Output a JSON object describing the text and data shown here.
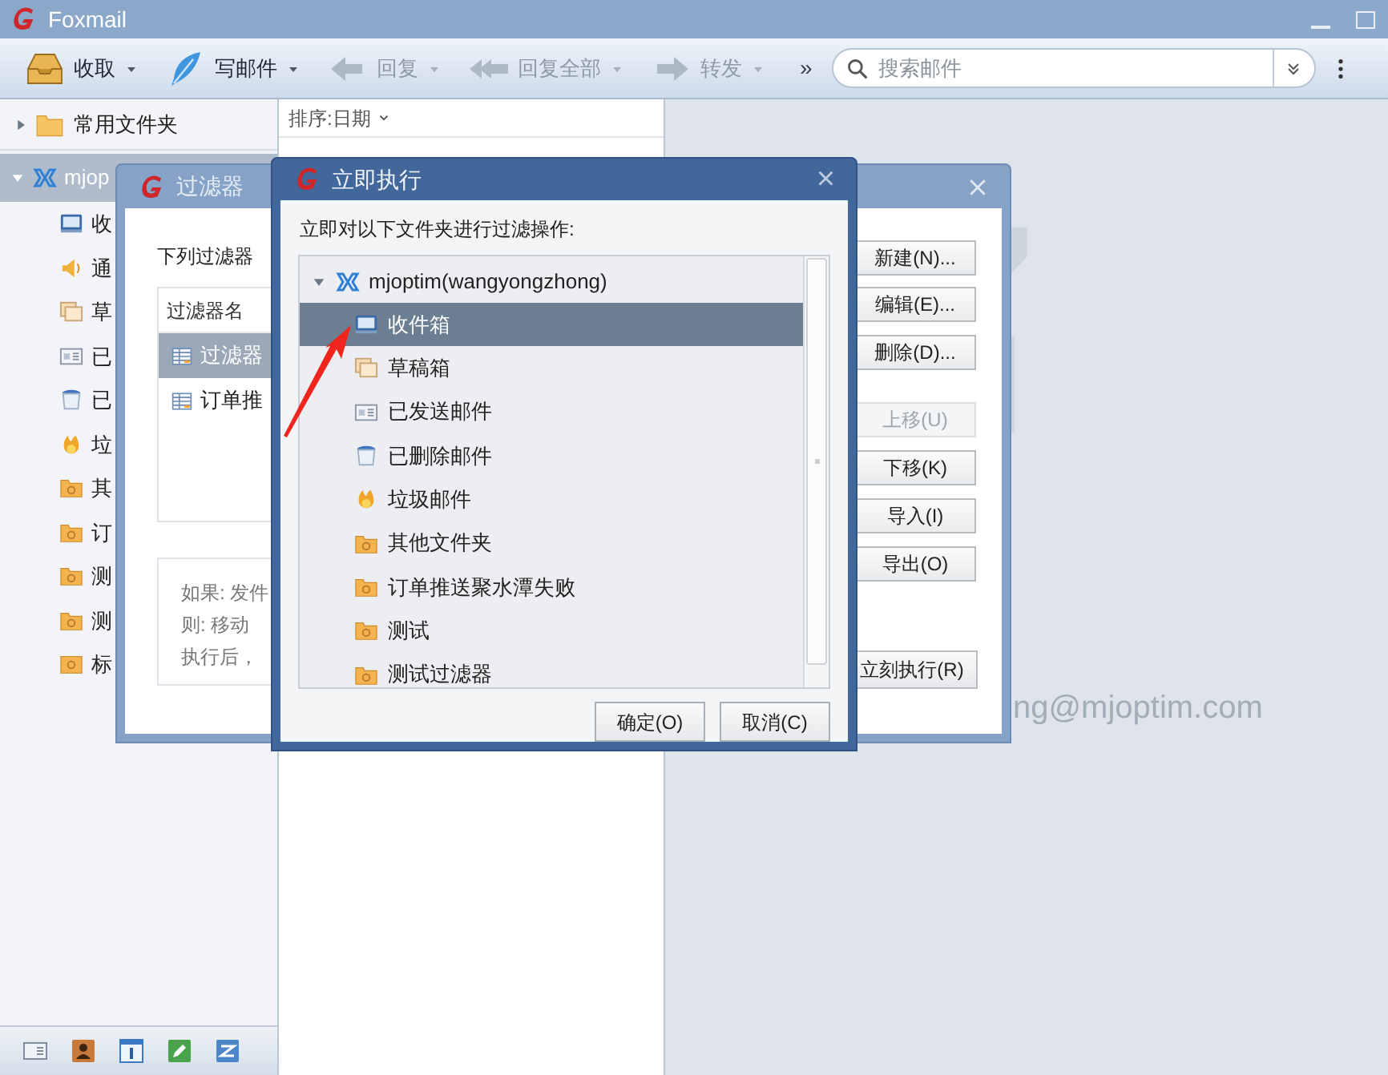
{
  "window": {
    "title": "Foxmail"
  },
  "toolbar": {
    "items": [
      {
        "kind": "receive",
        "label": "收取",
        "disabled": false
      },
      {
        "kind": "compose",
        "label": "写邮件",
        "disabled": false
      },
      {
        "kind": "reply",
        "label": "回复",
        "disabled": true
      },
      {
        "kind": "reply_all",
        "label": "回复全部",
        "disabled": true
      },
      {
        "kind": "forward",
        "label": "转发",
        "disabled": true
      }
    ],
    "more": "»",
    "search": {
      "placeholder": "搜索邮件"
    }
  },
  "sidebar": {
    "favorites": {
      "label": "常用文件夹",
      "expanded": false
    },
    "account": {
      "label": "mjop",
      "expanded": true,
      "selected": true
    },
    "folders": [
      {
        "kind": "inbox",
        "label": "收"
      },
      {
        "kind": "notice",
        "label": "通"
      },
      {
        "kind": "drafts",
        "label": "草"
      },
      {
        "kind": "sent",
        "label": "已"
      },
      {
        "kind": "deleted",
        "label": "已"
      },
      {
        "kind": "junk",
        "label": "垃"
      },
      {
        "kind": "folder",
        "label": "其"
      },
      {
        "kind": "folder",
        "label": "订"
      },
      {
        "kind": "folder",
        "label": "测"
      },
      {
        "kind": "folder",
        "label": "测"
      },
      {
        "kind": "tag",
        "label": "标"
      }
    ]
  },
  "message_list": {
    "sort_label": "排序:日期"
  },
  "reading_pane": {
    "account_text": "ng@mjoptim.com"
  },
  "filter_dialog": {
    "title": "过滤器",
    "intro": "下列过滤器",
    "column": "过滤器名",
    "rows": [
      {
        "label": "过滤器",
        "selected": true
      },
      {
        "label": "订单推",
        "selected": false
      }
    ],
    "rule_lines": [
      "如果: 发件",
      "则: 移动",
      "执行后，"
    ],
    "buttons": [
      {
        "label": "新建(N)...",
        "disabled": false
      },
      {
        "label": "编辑(E)...",
        "disabled": false
      },
      {
        "label": "删除(D)...",
        "disabled": false
      },
      {
        "label": "上移(U)",
        "disabled": true
      },
      {
        "label": "下移(K)",
        "disabled": false
      },
      {
        "label": "导入(I)",
        "disabled": false
      },
      {
        "label": "导出(O)",
        "disabled": false
      }
    ],
    "run_button": "立刻执行(R)"
  },
  "run_dialog": {
    "title": "立即执行",
    "close": "×",
    "prompt": "立即对以下文件夹进行过滤操作:",
    "tree": {
      "label": "mjoptim(wangyongzhong)",
      "expanded": true,
      "children": [
        {
          "kind": "inbox",
          "label": "收件箱",
          "selected": true
        },
        {
          "kind": "drafts",
          "label": "草稿箱",
          "selected": false
        },
        {
          "kind": "sent",
          "label": "已发送邮件",
          "selected": false
        },
        {
          "kind": "deleted",
          "label": "已删除邮件",
          "selected": false
        },
        {
          "kind": "junk",
          "label": "垃圾邮件",
          "selected": false
        },
        {
          "kind": "folder",
          "label": "其他文件夹",
          "selected": false
        },
        {
          "kind": "folder",
          "label": "订单推送聚水潭失败",
          "selected": false
        },
        {
          "kind": "folder",
          "label": "测试",
          "selected": false
        },
        {
          "kind": "folder",
          "label": "测试过滤器",
          "selected": false
        }
      ]
    },
    "buttons": [
      "确定(O)",
      "取消(C)"
    ]
  }
}
